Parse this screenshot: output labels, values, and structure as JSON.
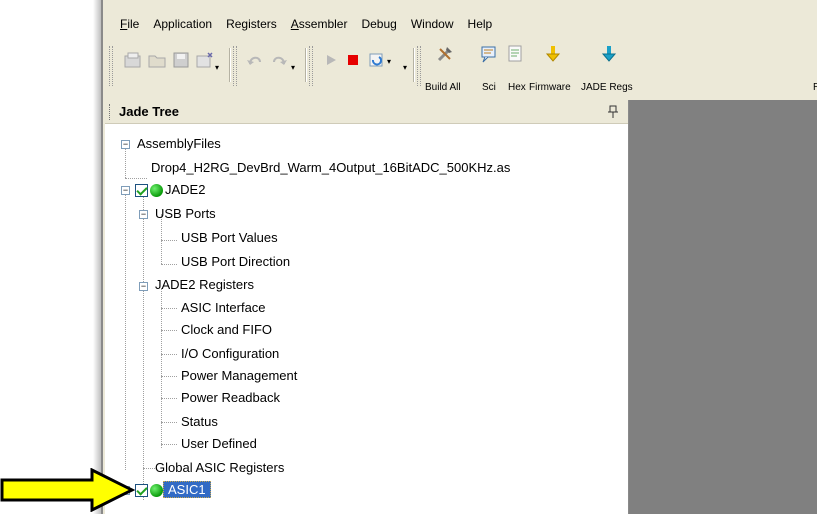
{
  "menubar": {
    "items": [
      {
        "label": "File",
        "accel": "F",
        "rest": "ile"
      },
      {
        "label": "Application",
        "accel": "",
        "rest": "Application"
      },
      {
        "label": "Registers",
        "accel": "",
        "rest": "Registers"
      },
      {
        "label": "Assembler",
        "accel": "A",
        "rest": "ssembler"
      },
      {
        "label": "Debug",
        "accel": "",
        "rest": "Debug"
      },
      {
        "label": "Window",
        "accel": "",
        "rest": "Window"
      },
      {
        "label": "Help",
        "accel": "",
        "rest": "Help"
      }
    ]
  },
  "toolbar": {
    "build_all": "Build All",
    "sci": "Sci",
    "hex": "Hex",
    "firmware": "Firmware",
    "jade_regs": "JADE Regs",
    "cut_label": "R"
  },
  "panel": {
    "title": "Jade Tree"
  },
  "tree": {
    "assembly_files": "AssemblyFiles",
    "assembly_file": "Drop4_H2RG_DevBrd_Warm_4Output_16BitADC_500KHz.as",
    "jade2": "JADE2",
    "usb_ports": "USB Ports",
    "usb_port_values": "USB Port Values",
    "usb_port_direction": "USB Port Direction",
    "jade2_registers": "JADE2 Registers",
    "asic_interface": "ASIC Interface",
    "clock_fifo": "Clock and FIFO",
    "io_config": "I/O Configuration",
    "power_mgmt": "Power Management",
    "power_readback": "Power Readback",
    "status": "Status",
    "user_defined": "User Defined",
    "global_asic": "Global ASIC Registers",
    "asic1": "ASIC1"
  },
  "colors": {
    "chrome": "#ece9d8",
    "selection": "#316ac5",
    "workspace": "#808080",
    "arrow": "#ffff00"
  }
}
